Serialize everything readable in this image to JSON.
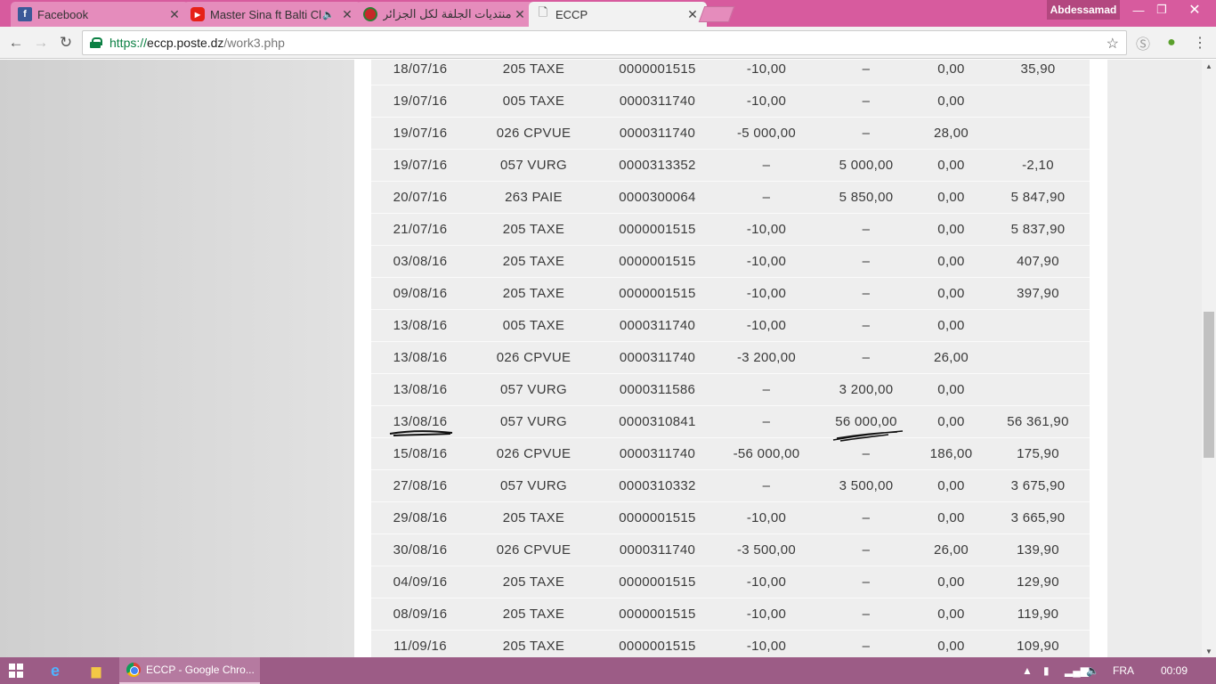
{
  "tabs": [
    {
      "title": "Facebook",
      "icon": "facebook-icon",
      "active": false
    },
    {
      "title": "Master Sina ft Balti Cl",
      "icon": "youtube-icon",
      "active": false
    },
    {
      "title": "منتديات الجلفة لكل الجزائر",
      "icon": "forum-icon",
      "active": false
    },
    {
      "title": "ECCP",
      "icon": "document-icon",
      "active": true
    }
  ],
  "profile_name": "Abdessamad",
  "address": {
    "scheme": "https://",
    "host": "eccp.poste.dz",
    "path": "/work3.php"
  },
  "rows": [
    {
      "date": "18/07/16",
      "op": "205 TAXE",
      "ref": "0000001515",
      "debit": "-10,00",
      "credit": "–",
      "fee": "0,00",
      "balance": "35,90"
    },
    {
      "date": "19/07/16",
      "op": "005 TAXE",
      "ref": "0000311740",
      "debit": "-10,00",
      "credit": "–",
      "fee": "0,00",
      "balance": ""
    },
    {
      "date": "19/07/16",
      "op": "026 CPVUE",
      "ref": "0000311740",
      "debit": "-5 000,00",
      "credit": "–",
      "fee": "28,00",
      "balance": ""
    },
    {
      "date": "19/07/16",
      "op": "057 VURG",
      "ref": "0000313352",
      "debit": "–",
      "credit": "5 000,00",
      "fee": "0,00",
      "balance": "-2,10"
    },
    {
      "date": "20/07/16",
      "op": "263 PAIE",
      "ref": "0000300064",
      "debit": "–",
      "credit": "5 850,00",
      "fee": "0,00",
      "balance": "5 847,90"
    },
    {
      "date": "21/07/16",
      "op": "205 TAXE",
      "ref": "0000001515",
      "debit": "-10,00",
      "credit": "–",
      "fee": "0,00",
      "balance": "5 837,90"
    },
    {
      "date": "03/08/16",
      "op": "205 TAXE",
      "ref": "0000001515",
      "debit": "-10,00",
      "credit": "–",
      "fee": "0,00",
      "balance": "407,90"
    },
    {
      "date": "09/08/16",
      "op": "205 TAXE",
      "ref": "0000001515",
      "debit": "-10,00",
      "credit": "–",
      "fee": "0,00",
      "balance": "397,90"
    },
    {
      "date": "13/08/16",
      "op": "005 TAXE",
      "ref": "0000311740",
      "debit": "-10,00",
      "credit": "–",
      "fee": "0,00",
      "balance": ""
    },
    {
      "date": "13/08/16",
      "op": "026 CPVUE",
      "ref": "0000311740",
      "debit": "-3 200,00",
      "credit": "–",
      "fee": "26,00",
      "balance": ""
    },
    {
      "date": "13/08/16",
      "op": "057 VURG",
      "ref": "0000311586",
      "debit": "–",
      "credit": "3 200,00",
      "fee": "0,00",
      "balance": ""
    },
    {
      "date": "13/08/16",
      "op": "057 VURG",
      "ref": "0000310841",
      "debit": "–",
      "credit": "56 000,00",
      "fee": "0,00",
      "balance": "56 361,90"
    },
    {
      "date": "15/08/16",
      "op": "026 CPVUE",
      "ref": "0000311740",
      "debit": "-56 000,00",
      "credit": "–",
      "fee": "186,00",
      "balance": "175,90"
    },
    {
      "date": "27/08/16",
      "op": "057 VURG",
      "ref": "0000310332",
      "debit": "–",
      "credit": "3 500,00",
      "fee": "0,00",
      "balance": "3 675,90"
    },
    {
      "date": "29/08/16",
      "op": "205 TAXE",
      "ref": "0000001515",
      "debit": "-10,00",
      "credit": "–",
      "fee": "0,00",
      "balance": "3 665,90"
    },
    {
      "date": "30/08/16",
      "op": "026 CPVUE",
      "ref": "0000311740",
      "debit": "-3 500,00",
      "credit": "–",
      "fee": "26,00",
      "balance": "139,90"
    },
    {
      "date": "04/09/16",
      "op": "205 TAXE",
      "ref": "0000001515",
      "debit": "-10,00",
      "credit": "–",
      "fee": "0,00",
      "balance": "129,90"
    },
    {
      "date": "08/09/16",
      "op": "205 TAXE",
      "ref": "0000001515",
      "debit": "-10,00",
      "credit": "–",
      "fee": "0,00",
      "balance": "119,90"
    },
    {
      "date": "11/09/16",
      "op": "205 TAXE",
      "ref": "0000001515",
      "debit": "-10,00",
      "credit": "–",
      "fee": "0,00",
      "balance": "109,90"
    }
  ],
  "taskbar": {
    "app_label": "ECCP - Google Chro...",
    "language": "FRA",
    "clock": "00:09"
  },
  "colors": {
    "tabstrip": "#d75b9e",
    "taskbar": "#9c5c86",
    "row_bg": "#eeeeee",
    "secure": "#0b8043"
  }
}
